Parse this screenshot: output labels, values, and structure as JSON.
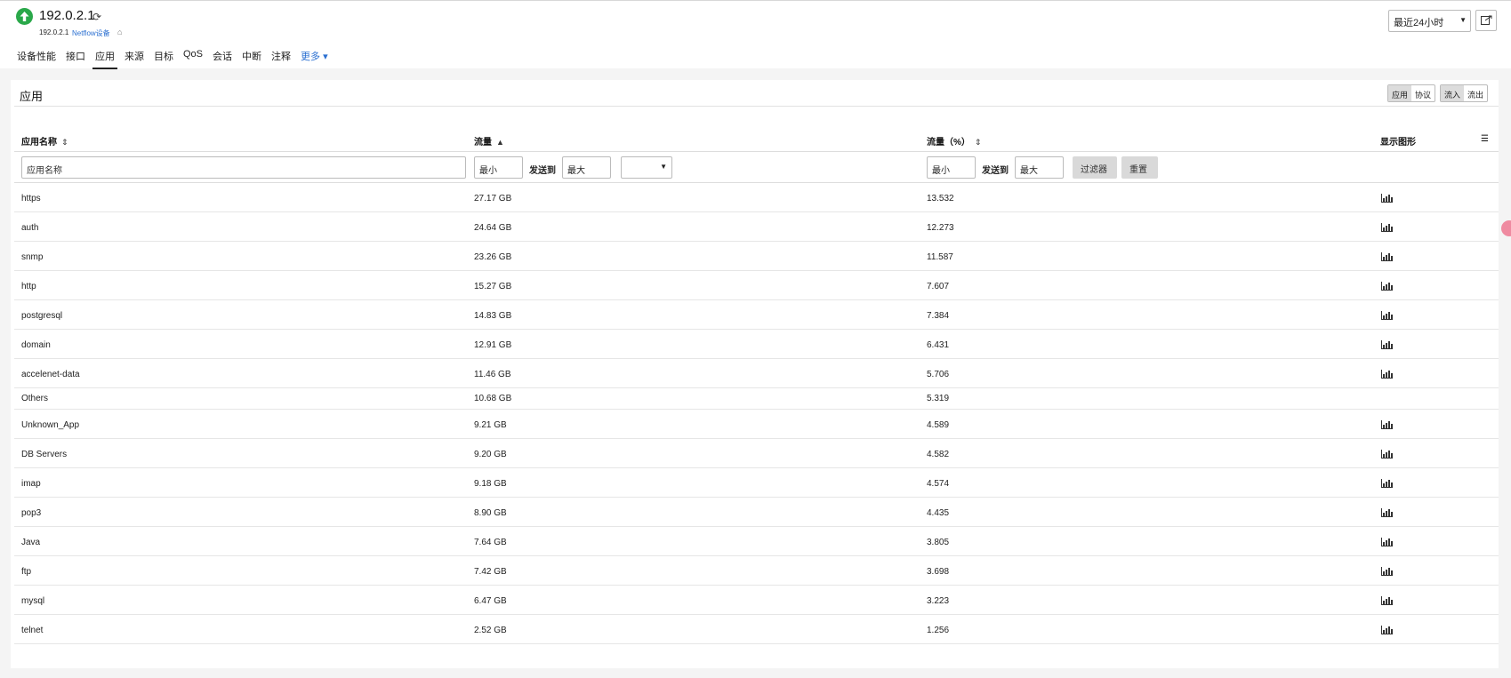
{
  "header": {
    "title": "192.0.2.1",
    "subtitle_ip": "192.0.2.1",
    "device_type": "Netflow设备",
    "time_range": "最近24小时",
    "status_color": "#2aa84a"
  },
  "nav": {
    "tabs": [
      "设备性能",
      "接口",
      "应用",
      "来源",
      "目标",
      "QoS",
      "会话",
      "中断",
      "注释"
    ],
    "more": "更多",
    "active": "应用"
  },
  "panel": {
    "title": "应用",
    "toggle_app": "应用",
    "toggle_protocol": "协议",
    "toggle_in": "流入",
    "toggle_out": "流出"
  },
  "table": {
    "columns": {
      "name": "应用名称",
      "traffic": "流量",
      "percent": "流量（%）",
      "graph": "显示图形"
    },
    "filters": {
      "name_placeholder": "应用名称",
      "min": "最小",
      "max": "最大",
      "send_to": "发送到",
      "filter_btn": "过滤器",
      "reset_btn": "重置"
    },
    "rows": [
      {
        "name": "https",
        "traffic": "27.17 GB",
        "percent": "13.532"
      },
      {
        "name": "auth",
        "traffic": "24.64 GB",
        "percent": "12.273"
      },
      {
        "name": "snmp",
        "traffic": "23.26 GB",
        "percent": "11.587"
      },
      {
        "name": "http",
        "traffic": "15.27 GB",
        "percent": "7.607"
      },
      {
        "name": "postgresql",
        "traffic": "14.83 GB",
        "percent": "7.384"
      },
      {
        "name": "domain",
        "traffic": "12.91 GB",
        "percent": "6.431"
      },
      {
        "name": "accelenet-data",
        "traffic": "11.46 GB",
        "percent": "5.706"
      },
      {
        "name": "Others",
        "traffic": "10.68 GB",
        "percent": "5.319"
      },
      {
        "name": "Unknown_App",
        "traffic": "9.21 GB",
        "percent": "4.589"
      },
      {
        "name": "DB Servers",
        "traffic": "9.20 GB",
        "percent": "4.582"
      },
      {
        "name": "imap",
        "traffic": "9.18 GB",
        "percent": "4.574"
      },
      {
        "name": "pop3",
        "traffic": "8.90 GB",
        "percent": "4.435"
      },
      {
        "name": "Java",
        "traffic": "7.64 GB",
        "percent": "3.805"
      },
      {
        "name": "ftp",
        "traffic": "7.42 GB",
        "percent": "3.698"
      },
      {
        "name": "mysql",
        "traffic": "6.47 GB",
        "percent": "3.223"
      },
      {
        "name": "telnet",
        "traffic": "2.52 GB",
        "percent": "1.256"
      }
    ]
  }
}
